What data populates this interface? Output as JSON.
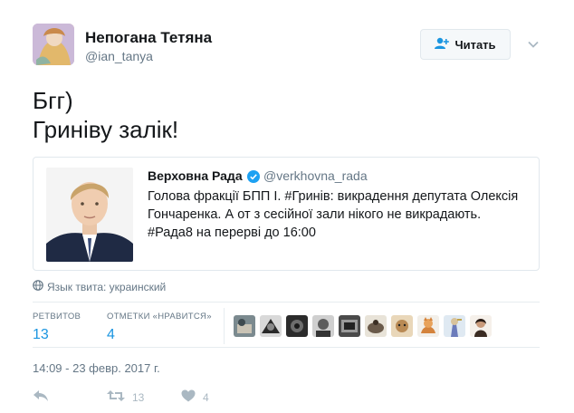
{
  "header": {
    "display_name": "Непогана Тетяна",
    "handle": "@ian_tanya",
    "follow_label": "Читать"
  },
  "tweet": {
    "text": "Бгг)\nГриніву залік!"
  },
  "quote": {
    "display_name": "Верховна Рада",
    "handle": "@verkhovna_rada",
    "text": "Голова фракції БПП І. #Гринів: викрадення депутата Олексія Гончаренка. А от з сесійної зали нікого не викрадають. #Рада8 на перерві до 16:00"
  },
  "language_line": "Язык твита: украинский",
  "stats": {
    "retweets_label": "РЕТВИТОВ",
    "retweets_value": "13",
    "likes_label": "ОТМЕТКИ «НРАВИТСЯ»",
    "likes_value": "4"
  },
  "timestamp": "14:09 - 23 февр. 2017 г.",
  "actions": {
    "retweet_count": "13",
    "like_count": "4"
  },
  "colors": {
    "accent": "#1b95e0",
    "muted": "#657786",
    "border": "#e1e8ed",
    "action_icon": "#aab8c2"
  },
  "icons": [
    "add-user-icon",
    "chevron-down-icon",
    "verified-icon",
    "globe-icon",
    "reply-icon",
    "retweet-icon",
    "heart-icon"
  ]
}
